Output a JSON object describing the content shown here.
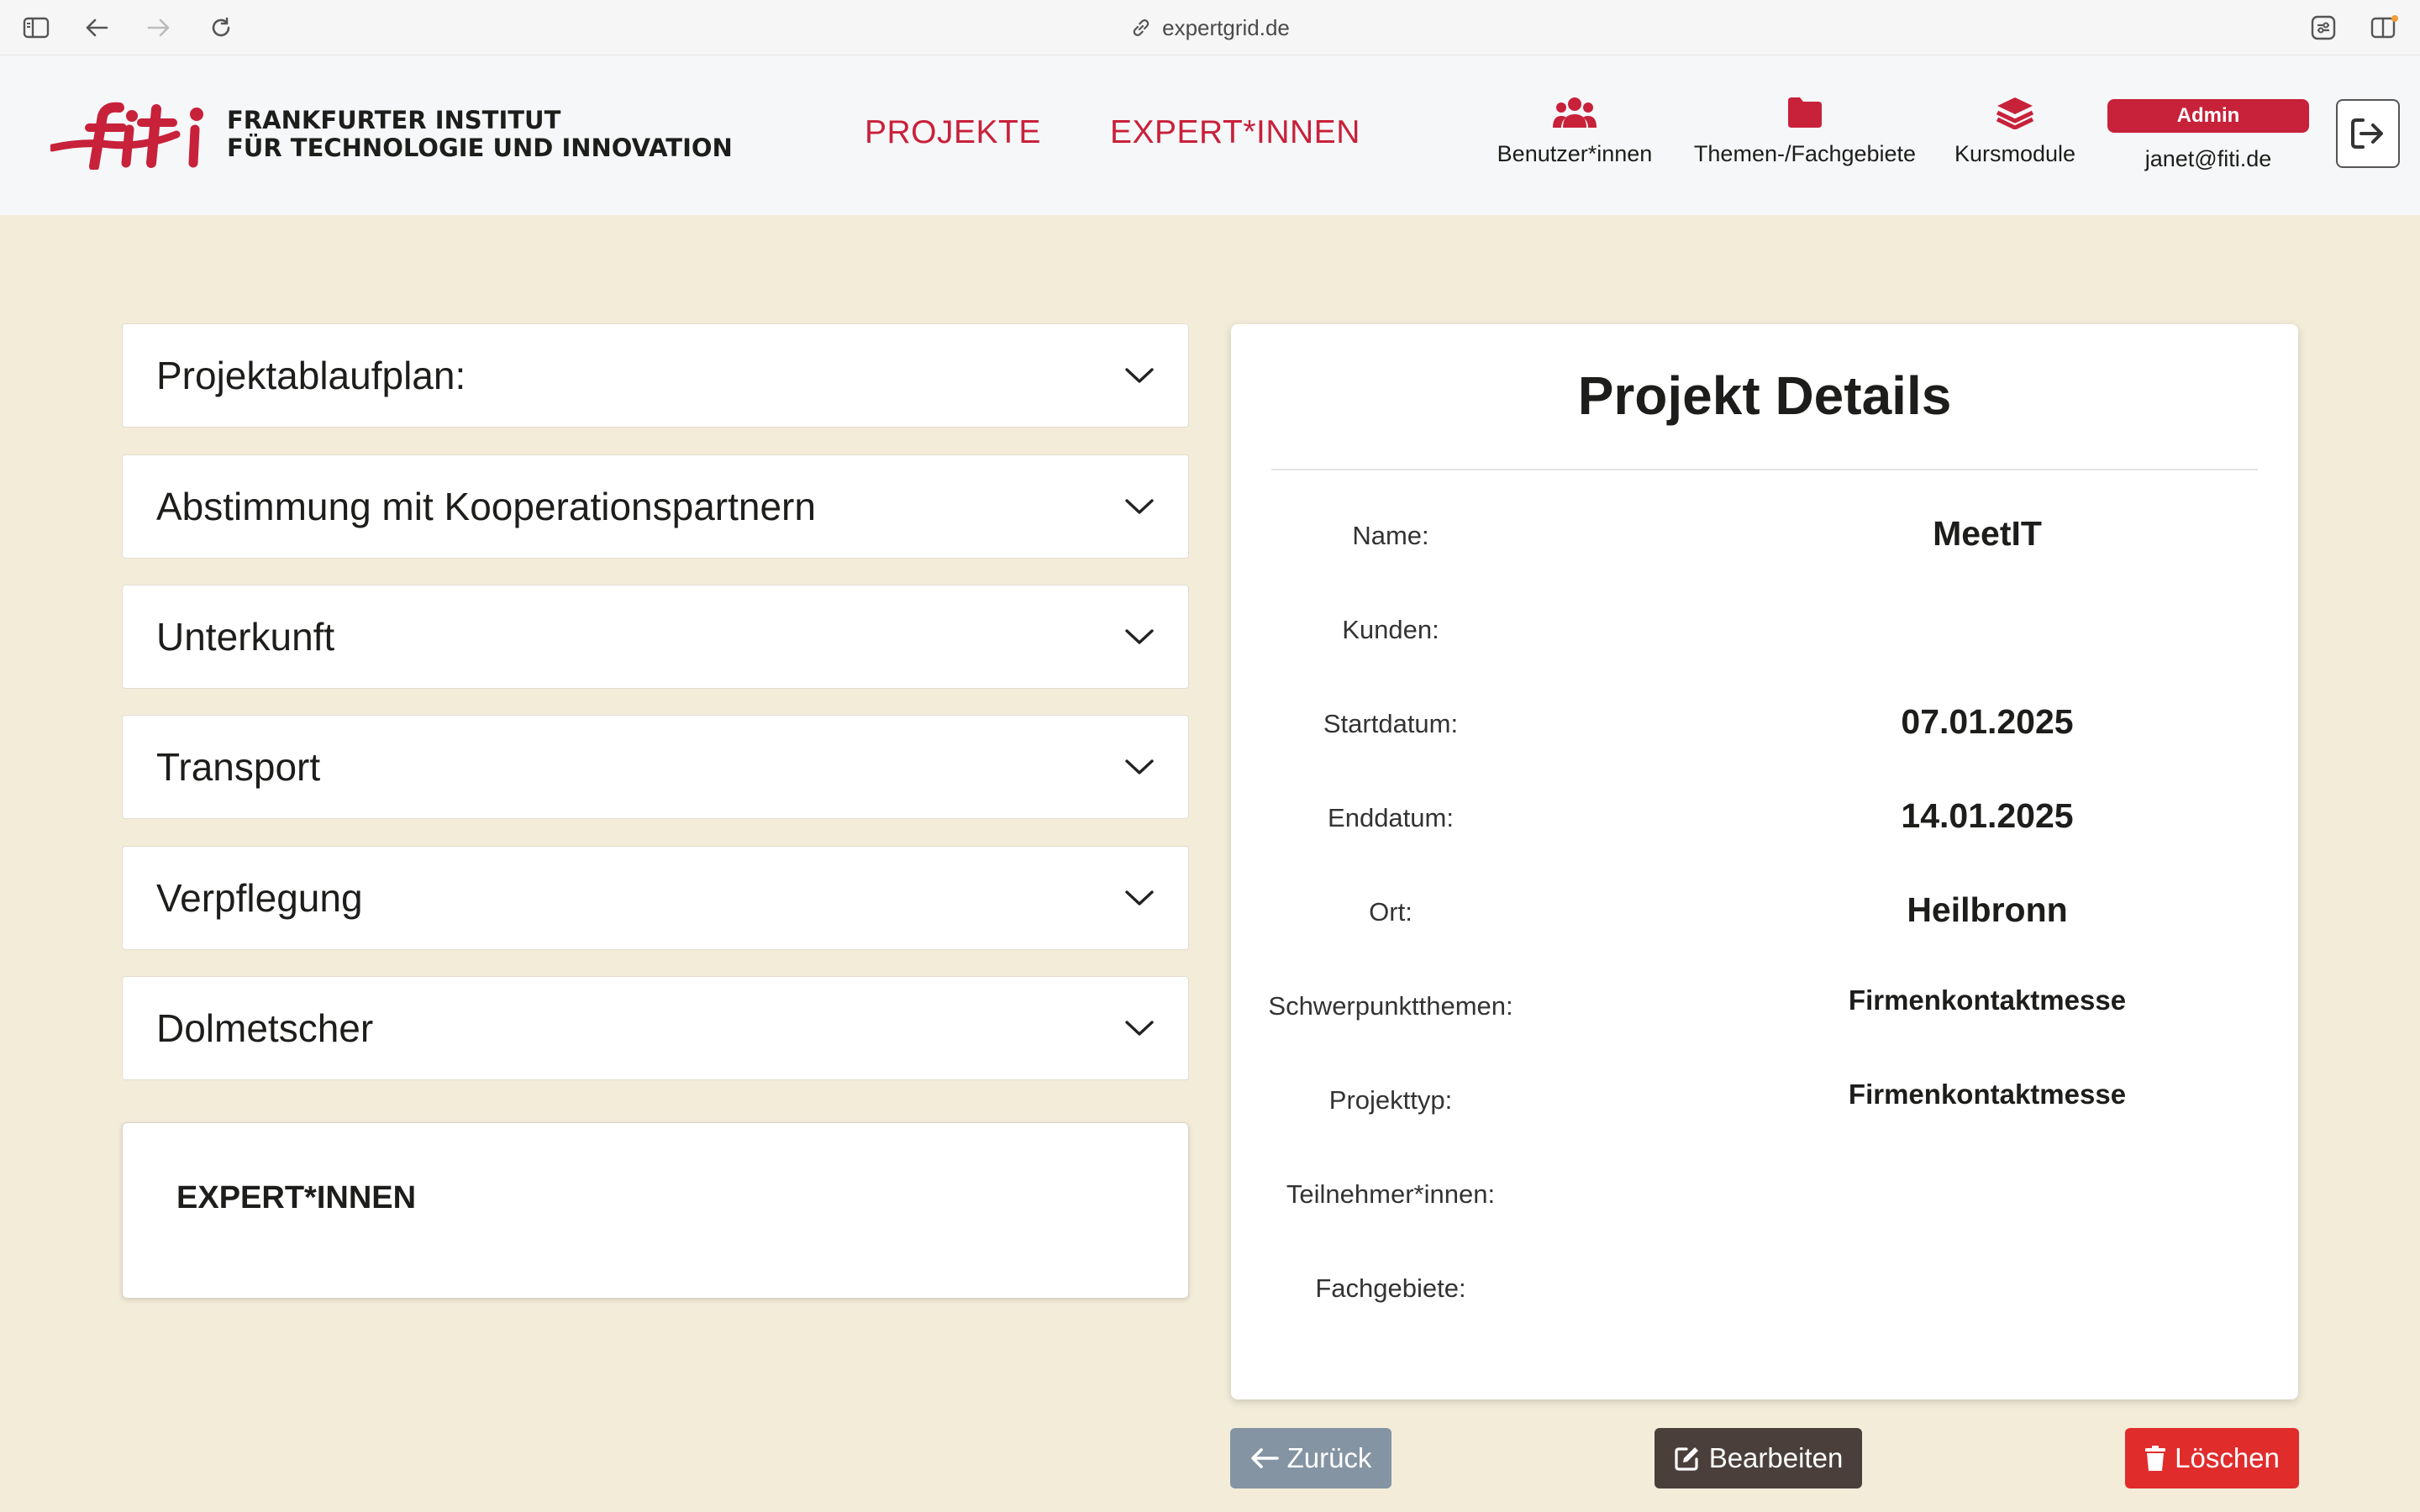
{
  "browser": {
    "url": "expertgrid.de"
  },
  "header": {
    "logo_mark": "FiTi",
    "logo_line1": "FRANKFURTER INSTITUT",
    "logo_line2": "FÜR TECHNOLOGIE UND INNOVATION",
    "nav_projects": "PROJEKTE",
    "nav_experts": "EXPERT*INNEN",
    "nav_users": "Benutzer*innen",
    "nav_topics": "Themen-/Fachgebiete",
    "nav_courses": "Kursmodule",
    "role_badge": "Admin",
    "user_email": "janet@fiti.de",
    "brand_color": "#c8213a"
  },
  "accordion": {
    "items": [
      {
        "label": "Projektablaufplan:"
      },
      {
        "label": "Abstimmung mit Kooperationspartnern"
      },
      {
        "label": "Unterkunft"
      },
      {
        "label": "Transport"
      },
      {
        "label": "Verpflegung"
      },
      {
        "label": "Dolmetscher"
      }
    ]
  },
  "experts_section": {
    "title": "EXPERT*INNEN"
  },
  "details": {
    "title": "Projekt Details",
    "rows": [
      {
        "label": "Name:",
        "value": "MeetIT"
      },
      {
        "label": "Kunden:",
        "value": ""
      },
      {
        "label": "Startdatum:",
        "value": "07.01.2025"
      },
      {
        "label": "Enddatum:",
        "value": "14.01.2025"
      },
      {
        "label": "Ort:",
        "value": "Heilbronn"
      },
      {
        "label": "Schwerpunktthemen:",
        "value": "Firmenkontaktmesse"
      },
      {
        "label": "Projekttyp:",
        "value": "Firmenkontaktmesse"
      },
      {
        "label": "Teilnehmer*innen:",
        "value": ""
      },
      {
        "label": "Fachgebiete:",
        "value": ""
      }
    ]
  },
  "actions": {
    "back_label": "Zurück",
    "edit_label": "Bearbeiten",
    "delete_label": "Löschen",
    "back_color": "#8494a3",
    "edit_color": "#4a3f3b",
    "delete_color": "#e12c2c"
  }
}
